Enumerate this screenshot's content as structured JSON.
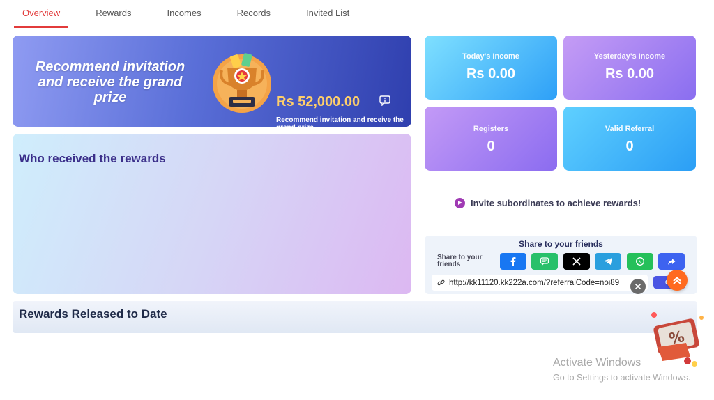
{
  "tabs": [
    {
      "label": "Overview",
      "active": true
    },
    {
      "label": "Rewards",
      "active": false
    },
    {
      "label": "Incomes",
      "active": false
    },
    {
      "label": "Records",
      "active": false
    },
    {
      "label": "Invited List",
      "active": false
    }
  ],
  "banner": {
    "title": "Recommend invitation and receive the grand prize",
    "prize_amount": "Rs  52,000.00",
    "prize_subtitle": "Recommend invitation and receive the grand prize",
    "trophy_icon": "trophy-icon",
    "chat_icon": "chat-bubble-icon"
  },
  "received": {
    "title": "Who received the rewards"
  },
  "released": {
    "title": "Rewards Released to Date"
  },
  "stats": {
    "today_income": {
      "label": "Today's Income",
      "value": "Rs  0.00"
    },
    "yesterday_income": {
      "label": "Yesterday's Income",
      "value": "Rs  0.00"
    },
    "registers": {
      "label": "Registers",
      "value": "0"
    },
    "valid_referral": {
      "label": "Valid Referral",
      "value": "0"
    }
  },
  "invite": {
    "text": "Invite subordinates to achieve rewards!"
  },
  "share": {
    "title": "Share to your friends",
    "label": "Share to your friends",
    "buttons": [
      {
        "name": "facebook",
        "icon": "facebook-icon",
        "color": "#1877f2"
      },
      {
        "name": "sms",
        "icon": "message-icon",
        "color": "#28c06a"
      },
      {
        "name": "x",
        "icon": "x-icon",
        "color": "#000000"
      },
      {
        "name": "telegram",
        "icon": "telegram-icon",
        "color": "#2a9fde"
      },
      {
        "name": "whatsapp",
        "icon": "whatsapp-icon",
        "color": "#25c05a"
      },
      {
        "name": "share",
        "icon": "share-arrow-icon",
        "color": "#3d63f0"
      }
    ],
    "link": "http://kk11120.kk222a.com/?referralCode=noi89",
    "copy_label": "Co"
  },
  "colors": {
    "accent": "#e23b3b",
    "title_purple": "#3b2f8a",
    "prize_gold": "#ffcf6a",
    "scroll_top": "#ff6a1f"
  },
  "watermark": {
    "line1": "Activate Windows",
    "line2": "Go to Settings to activate Windows."
  }
}
